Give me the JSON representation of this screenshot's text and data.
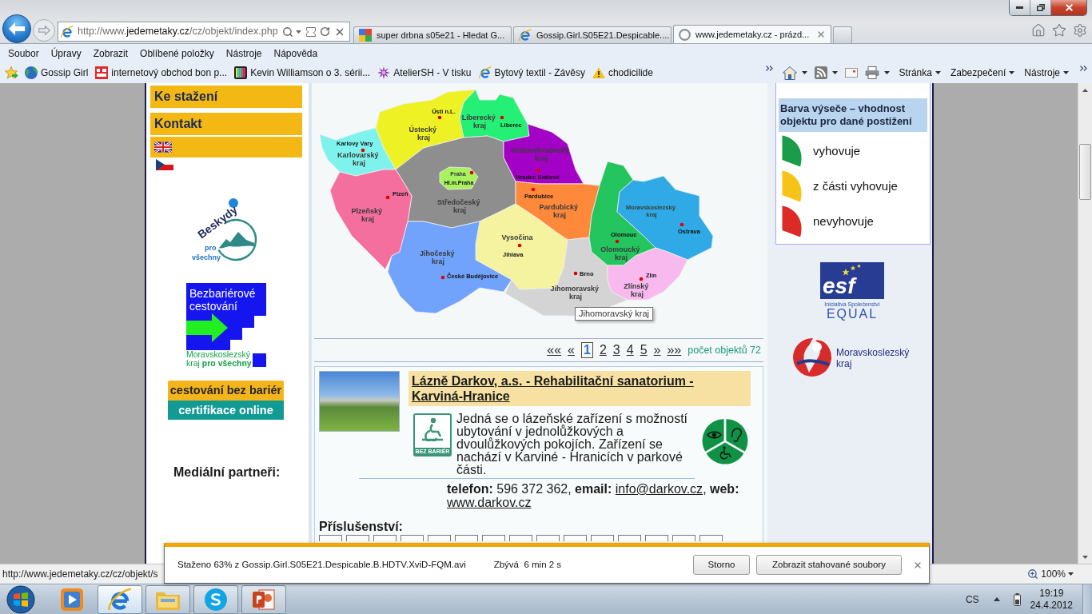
{
  "tabs": [
    {
      "title": "super drbna s05e21 - Hledat G...",
      "kind": "google",
      "selected": false
    },
    {
      "title": "Gossip.Girl.S05E21.Despicable....",
      "kind": "ie",
      "selected": false
    },
    {
      "title": "www.jedemetaky.cz - prázd...",
      "kind": "loading",
      "selected": true
    }
  ],
  "address_bar": {
    "prefix": "http://www.",
    "domain": "jedemetaky.cz",
    "path": "/cz/objekt/index.php"
  },
  "menu_bar": [
    "Soubor",
    "Úpravy",
    "Zobrazit",
    "Oblíbené položky",
    "Nástroje",
    "Nápověda"
  ],
  "favorites_bar": [
    {
      "label": "Gossip Girl",
      "kind": "globe"
    },
    {
      "label": "internetový obchod bon p...",
      "kind": "bon"
    },
    {
      "label": "Kevin Williamson o 3. sérii...",
      "kind": "tv"
    },
    {
      "label": "AtelierSH - V tisku",
      "kind": "flower"
    },
    {
      "label": "Bytový textil - Závěsy",
      "kind": "ie"
    },
    {
      "label": "chodicilide",
      "kind": "warning"
    }
  ],
  "command_bar": [
    "Stránka",
    "Zabezpečení",
    "Nástroje"
  ],
  "sidebar": {
    "menu": [
      "Ke stažení",
      "Kontakt"
    ],
    "logos": {
      "beskydy": {
        "name": "Beskydy",
        "tagline": [
          "pro",
          "všechny"
        ]
      },
      "bezbarierove": {
        "title": [
          "Bezbariérové",
          "cestování"
        ],
        "caption": [
          "Moravskoslezský",
          "kraj **pro všechny**"
        ]
      },
      "certifikace": {
        "top": "cestování bez bariér",
        "bottom": "certifikace online"
      }
    },
    "partners_heading": "Mediální partneři:"
  },
  "map": {
    "regions": [
      {
        "name": "Karlovarský kraj",
        "city": "Karlovy Vary",
        "color": "#7ef3ee"
      },
      {
        "name": "Ústecký kraj",
        "city": "Ústí n.L.",
        "color": "#eef224"
      },
      {
        "name": "Liberecký kraj",
        "city": "Liberec",
        "color": "#26ef76"
      },
      {
        "name": "Praha",
        "city": "Hl.m.Praha",
        "color": "#a8f25f"
      },
      {
        "name": "Středočeský kraj",
        "color": "#8e8e8e"
      },
      {
        "name": "Královéhradecký kraj",
        "city": "Hradec Králové",
        "color": "#a301c6"
      },
      {
        "name": "Plzeňský kraj",
        "city": "Plzeň",
        "color": "#f46f9e"
      },
      {
        "name": "Pardubický kraj",
        "city": "Pardubice",
        "color": "#ff893b"
      },
      {
        "name": "Vysočina",
        "city": "Jihlava",
        "color": "#f5f39f"
      },
      {
        "name": "Jihočeský kraj",
        "city": "České Budějovice",
        "color": "#71a2fc"
      },
      {
        "name": "Jihomoravský kraj",
        "city": "Brno",
        "color": "#d4d4d4"
      },
      {
        "name": "Olomoucký kraj",
        "city": "Olomouc",
        "color": "#24c45e"
      },
      {
        "name": "Moravskoslezský kraj",
        "city": "Ostrava",
        "color": "#2faae6"
      },
      {
        "name": "Zlínský kraj",
        "city": "Zlín",
        "color": "#f8b9ef"
      }
    ],
    "tooltip": "Jihomoravský kraj"
  },
  "pagination": {
    "links": [
      {
        "label": "««",
        "selected": false
      },
      {
        "label": "«",
        "selected": false
      },
      {
        "label": "1",
        "selected": true
      },
      {
        "label": "2",
        "selected": false
      },
      {
        "label": "3",
        "selected": false
      },
      {
        "label": "4",
        "selected": false
      },
      {
        "label": "5",
        "selected": false
      },
      {
        "label": "»",
        "selected": false
      },
      {
        "label": "»»",
        "selected": false
      }
    ],
    "count": "počet objektů 72"
  },
  "listing": {
    "title": "Lázně Darkov, a.s. - Rehabilitační sanatorium - Karviná-Hranice",
    "logo_caption": "BEZ BARIÉR",
    "description": "Jedná se o lázeňské zařízení s možností ubytování v jednolůžkových a dvoulůžkových pokojích. Zařízení se nachází v Karviné - Hranicích v parkové části.",
    "suitability": [
      {
        "kind": "vision",
        "color": "#0f9146"
      },
      {
        "kind": "hearing",
        "color": "#0f9146"
      },
      {
        "kind": "mobility",
        "color": "#0f9146"
      }
    ],
    "contact": [
      {
        "kind": "text",
        "text": "**telefon:** 596 372 362, **email:** "
      },
      {
        "kind": "link",
        "text": "info@darkov.cz"
      },
      {
        "kind": "text",
        "text": ", **web:** "
      },
      {
        "kind": "link",
        "text": "www.darkov.cz"
      }
    ],
    "amenities_heading": "Příslušenství:"
  },
  "legend": {
    "heading": "Barva výseče – vhodnost objektu pro dané postižení",
    "items": [
      {
        "label": "vyhovuje",
        "color": "#1b9c48"
      },
      {
        "label": "z části vyhovuje",
        "color": "#f6c416"
      },
      {
        "label": "nevyhovuje",
        "color": "#dc2a26"
      }
    ]
  },
  "partner_logos": {
    "esf": {
      "mark": "esf",
      "caption": "Iniciativa Společenství",
      "name": "EQUAL"
    },
    "region": [
      "Moravskoslezský",
      "kraj"
    ]
  },
  "download_bar": {
    "status": "Staženo 63% z Gossip.Girl.S05E21.Despicable.B.HDTV.XviD-FQM.avi",
    "remaining": "Zbývá  6 min 2 s",
    "buttons": [
      "Storno",
      "Zobrazit stahované soubory"
    ]
  },
  "status_bar": {
    "url": "http://www.jedemetaky.cz/cz/objekt/s",
    "zoom": "100%"
  },
  "taskbar": {
    "apps": [
      {
        "kind": "media",
        "running": false,
        "selected": false
      },
      {
        "kind": "ie",
        "running": true,
        "selected": true
      },
      {
        "kind": "explorer",
        "running": true,
        "selected": false
      },
      {
        "kind": "skype",
        "running": true,
        "selected": false
      },
      {
        "kind": "powerpoint",
        "running": true,
        "selected": false
      }
    ],
    "language": "CS",
    "time": "19:19",
    "date": "24.4.2012"
  }
}
